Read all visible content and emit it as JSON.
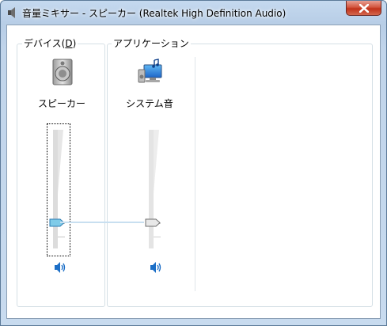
{
  "window": {
    "title": "音量ミキサー - スピーカー (Realtek High Definition Audio)",
    "close_label": "close"
  },
  "device_panel": {
    "legend_prefix": "デバイス(",
    "legend_accel": "D",
    "legend_suffix": ")",
    "channel": {
      "label": "スピーカー",
      "icon": "speaker-device-icon",
      "volume_fraction": 0.22,
      "muted": false
    }
  },
  "apps_panel": {
    "legend": "アプリケーション",
    "channels": [
      {
        "label": "システム音",
        "icon": "system-sounds-icon",
        "volume_fraction": 0.22,
        "muted": false
      }
    ]
  },
  "colors": {
    "titlebar": "#b7cde6",
    "close_button": "#c0321a",
    "accent_blue": "#1c6fc7",
    "thumb_active": "#7fcbe8",
    "thumb_inactive": "#e8e8e8"
  }
}
